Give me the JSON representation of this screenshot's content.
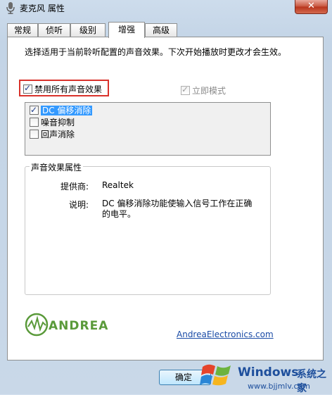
{
  "window": {
    "title": "麦克风 属性",
    "close_label": "✕"
  },
  "tabs": [
    {
      "label": "常规"
    },
    {
      "label": "侦听"
    },
    {
      "label": "级别"
    },
    {
      "label": "增强",
      "active": true
    },
    {
      "label": "高级"
    }
  ],
  "panel": {
    "description": "选择适用于当前聆听配置的声音效果。下次开始播放时更改才会生效。",
    "disable_all": {
      "label": "禁用所有声音效果",
      "checked": true
    },
    "immediate_mode": {
      "label": "立即模式",
      "checked": true,
      "disabled": true
    },
    "effects": [
      {
        "label": "DC 偏移消除",
        "checked": true,
        "selected": true
      },
      {
        "label": "噪音抑制",
        "checked": false
      },
      {
        "label": "回声消除",
        "checked": false
      }
    ],
    "properties": {
      "group_title": "声音效果属性",
      "provider_label": "提供商:",
      "provider_value": "Realtek",
      "desc_label": "说明:",
      "desc_value": "DC 偏移消除功能使输入信号工作在正确的电平。"
    },
    "brand": {
      "logo_text": "ANDREA",
      "link": "AndreaElectronics.com"
    }
  },
  "buttons": {
    "ok_label": "确定"
  },
  "watermark": {
    "brand": "Windows",
    "cn_text": "系统之家",
    "url": "www.bjjmlv.com"
  },
  "colors": {
    "highlight": "#d9322b",
    "selection": "#3399ff",
    "link": "#1a4ba6"
  }
}
